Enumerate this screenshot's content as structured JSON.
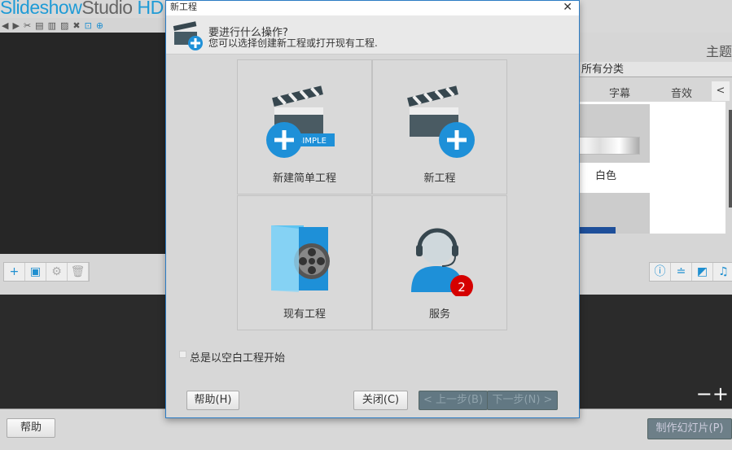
{
  "app": {
    "title_a": "Slideshow",
    "title_b": "Studio",
    "title_c": "HD",
    "help": "帮助",
    "make": "制作幻灯片(P)",
    "theme": "主题",
    "category": "所有分类",
    "tabs": [
      "字幕",
      "音效"
    ],
    "tab_prev": "<",
    "thumb_label": "白色"
  },
  "dialog": {
    "title": "新工程",
    "heading": "要进行什么操作?",
    "subheading": "您可以选择创建新工程或打开现有工程.",
    "options": [
      {
        "label": "新建简单工程",
        "badge": "SIMPLE"
      },
      {
        "label": "新工程"
      },
      {
        "label": "现有工程"
      },
      {
        "label": "服务",
        "count": "2"
      }
    ],
    "checkbox": "总是以空白工程开始",
    "help": "帮助(H)",
    "close": "关闭(C)",
    "back": "< 上一步(B)",
    "next": "下一步(N) >"
  },
  "colors": {
    "accent": "#1f9bd6",
    "disabled": "#627883"
  }
}
